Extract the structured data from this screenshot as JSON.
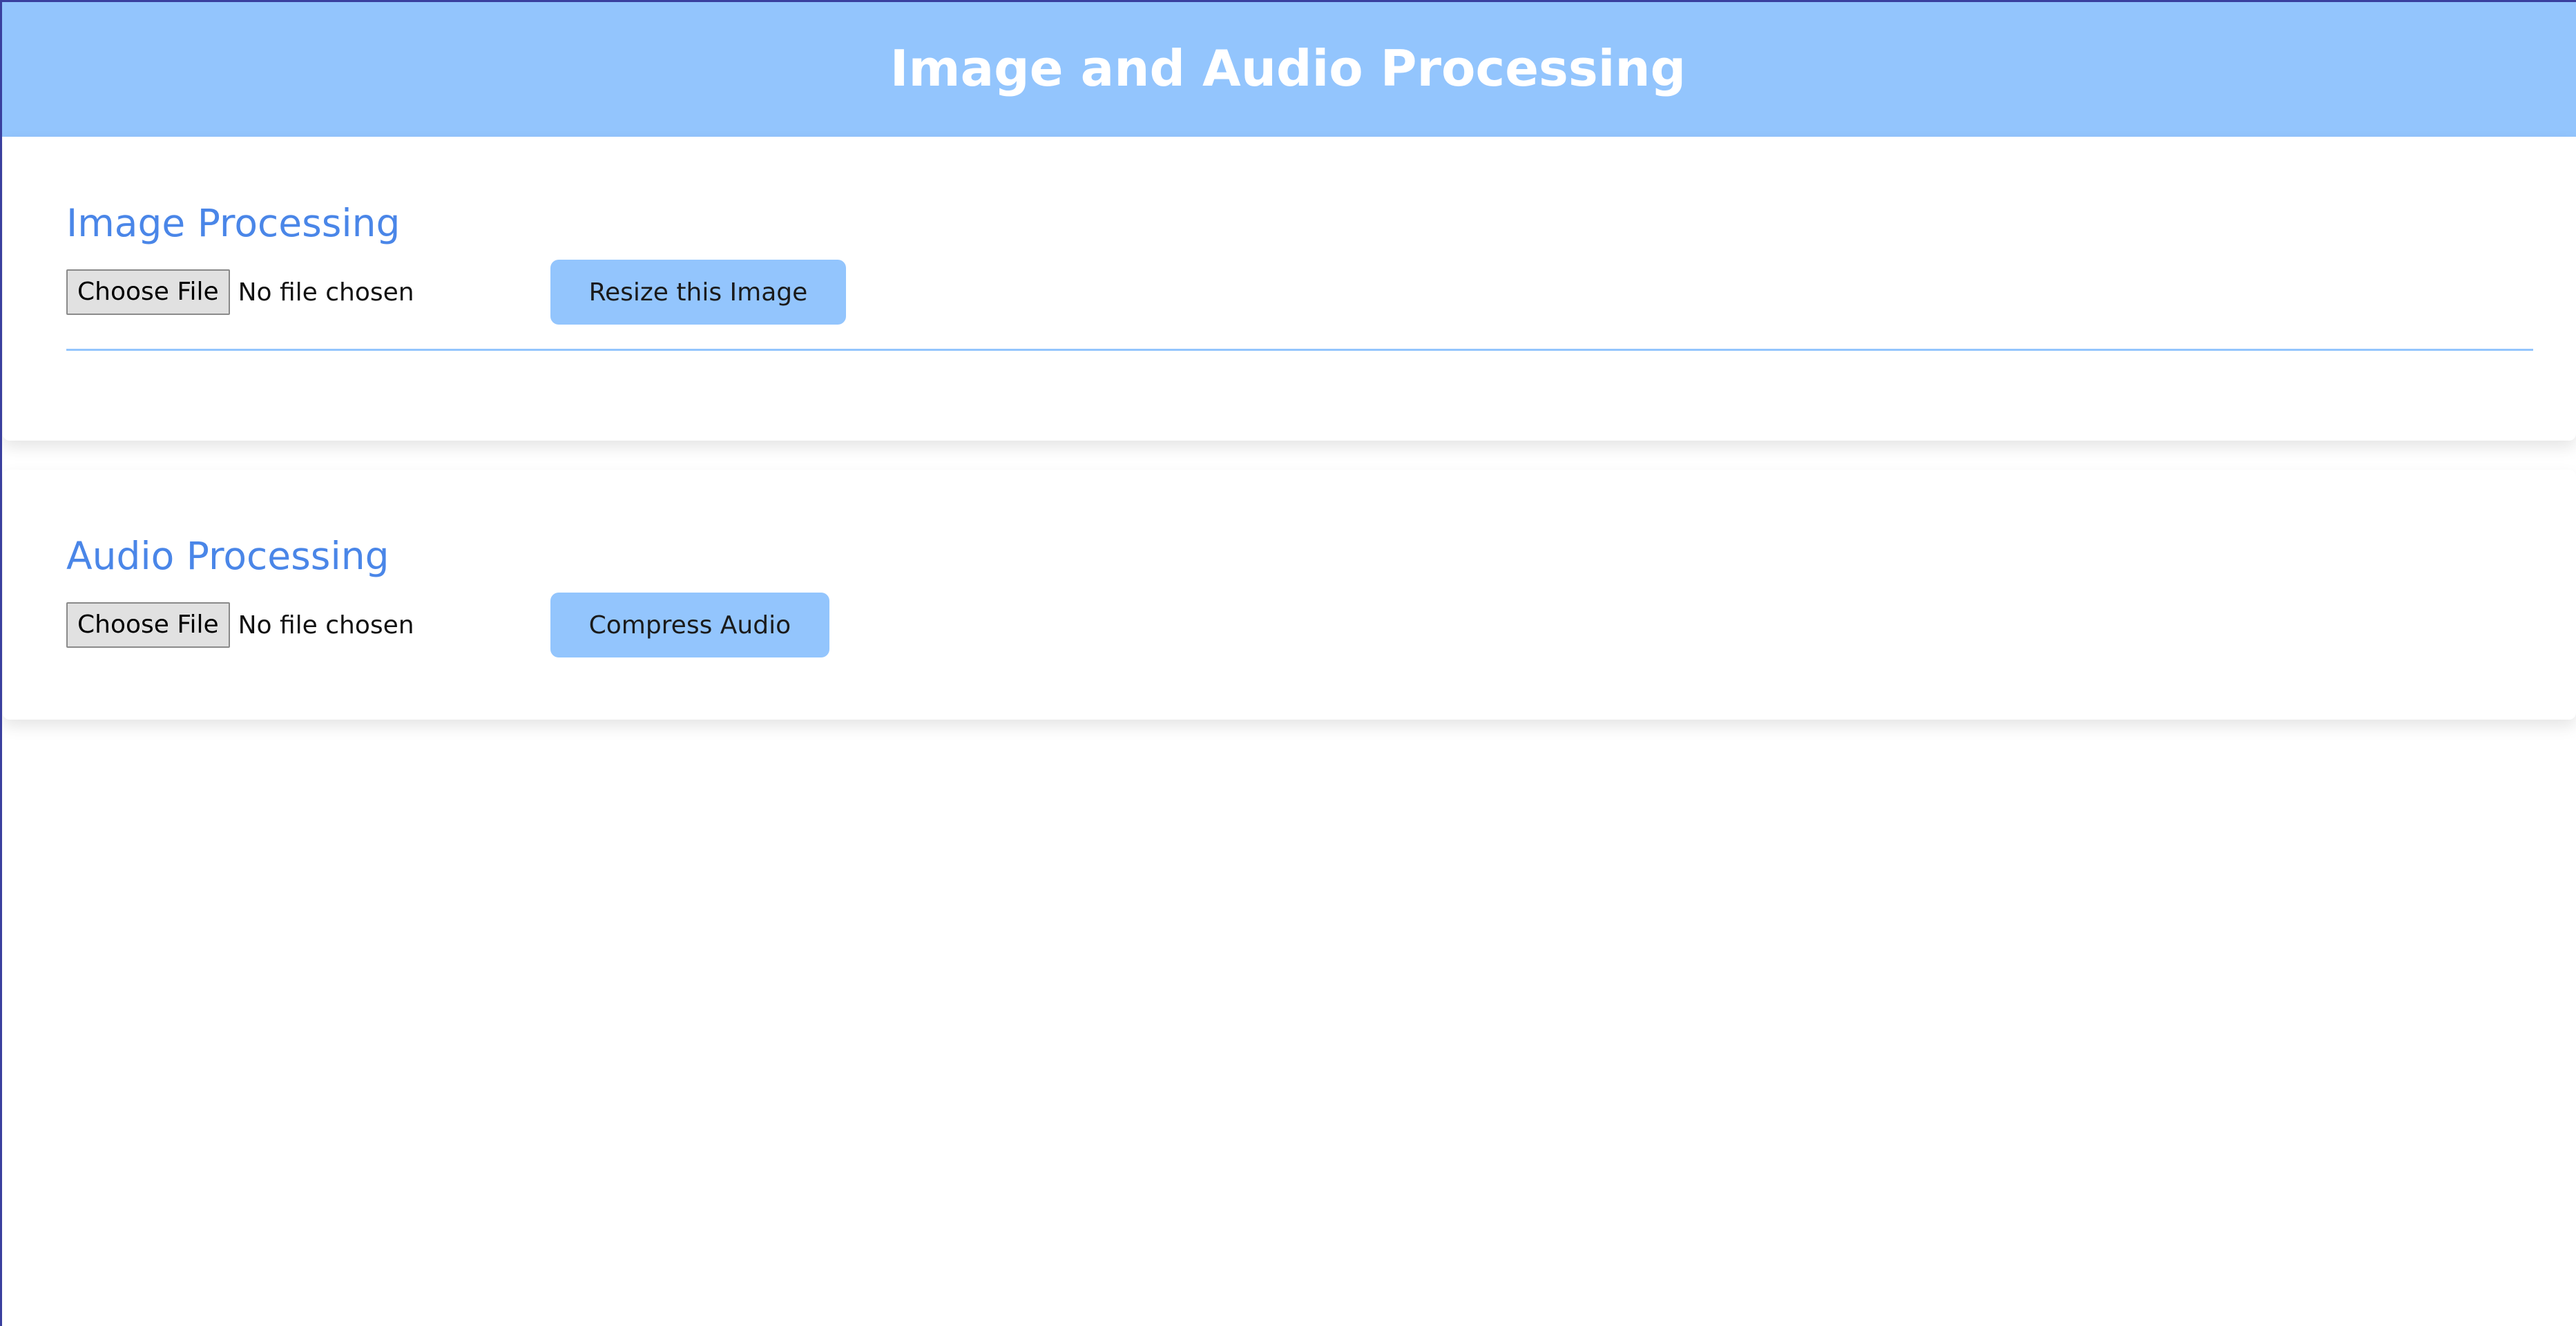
{
  "header": {
    "title": "Image and Audio Processing"
  },
  "image_section": {
    "title": "Image Processing",
    "choose_file_label": "Choose File",
    "file_status": "No file chosen",
    "action_label": "Resize this Image"
  },
  "audio_section": {
    "title": "Audio Processing",
    "choose_file_label": "Choose File",
    "file_status": "No file chosen",
    "action_label": "Compress Audio"
  },
  "colors": {
    "header_bg": "#93c5fd",
    "accent_text": "#4a86e8",
    "button_bg": "#93c5fd"
  }
}
